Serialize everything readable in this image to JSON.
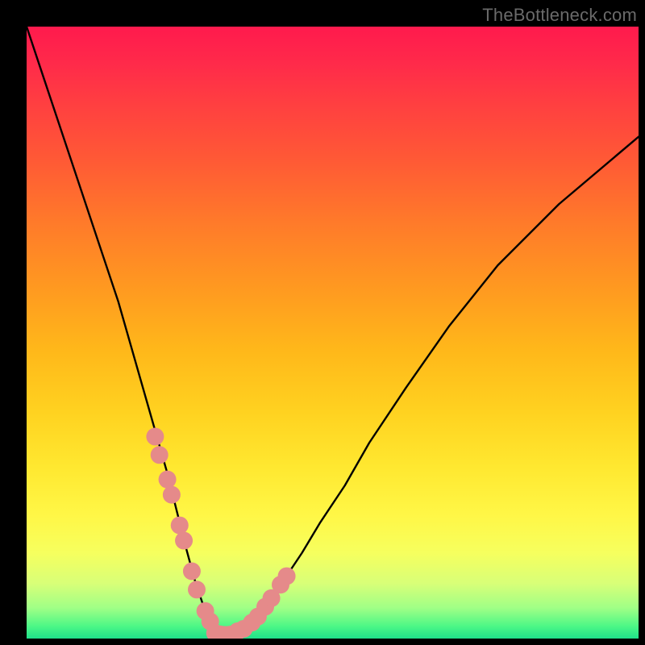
{
  "watermark": "TheBottleneck.com",
  "chart_data": {
    "type": "line",
    "title": "",
    "xlabel": "",
    "ylabel": "",
    "xlim": [
      0,
      100
    ],
    "ylim": [
      0,
      100
    ],
    "gradient_background": true,
    "series": [
      {
        "name": "curve",
        "x": [
          0,
          3,
          6,
          9,
          12,
          15,
          17,
          19,
          21,
          23,
          24.5,
          26,
          27.5,
          29,
          30.2,
          31.4,
          32.6,
          34,
          36,
          38,
          40,
          42,
          45,
          48,
          52,
          56,
          62,
          69,
          77,
          87,
          100
        ],
        "y": [
          100,
          91,
          82,
          73,
          64,
          55,
          48,
          41,
          34,
          27,
          21,
          15,
          9.5,
          5,
          2.2,
          0.9,
          0.6,
          0.8,
          2.0,
          4.0,
          6.5,
          9.5,
          14,
          19,
          25,
          32,
          41,
          51,
          61,
          71,
          82
        ]
      },
      {
        "name": "left-beads",
        "type": "scatter",
        "x": [
          21.0,
          21.7,
          23.0,
          23.7,
          25.0,
          25.7,
          27.0,
          27.8,
          29.2,
          30.0
        ],
        "y": [
          33.0,
          30.0,
          26.0,
          23.5,
          18.5,
          16.0,
          11.0,
          8.0,
          4.5,
          2.8
        ]
      },
      {
        "name": "right-beads",
        "type": "scatter",
        "x": [
          34.5,
          35.5,
          36.8,
          37.8,
          39.0,
          40.0,
          41.5,
          42.5
        ],
        "y": [
          1.2,
          1.6,
          2.6,
          3.6,
          5.2,
          6.6,
          8.8,
          10.2
        ]
      },
      {
        "name": "bottom-beads",
        "type": "scatter",
        "x": [
          30.8,
          31.6,
          32.4,
          33.2,
          34.0
        ],
        "y": [
          0.9,
          0.7,
          0.6,
          0.65,
          0.8
        ]
      }
    ],
    "bead_color": "#e58a8a",
    "curve_color": "#000000"
  }
}
